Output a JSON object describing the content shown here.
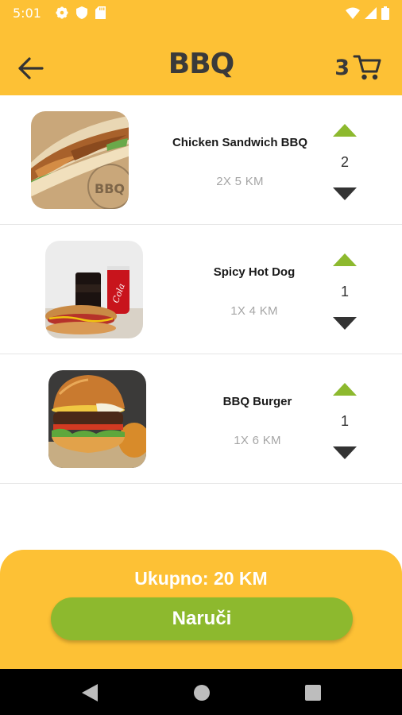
{
  "status_bar": {
    "time": "5:01",
    "left_icons": [
      "gear-icon",
      "shield-icon",
      "sd-card-icon"
    ],
    "right_icons": [
      "wifi-icon",
      "signal-icon",
      "battery-icon"
    ]
  },
  "app_bar": {
    "title": "BBQ",
    "back_icon": "arrow-left-icon",
    "cart_icon": "cart-icon",
    "cart_count": "3"
  },
  "cart_items": [
    {
      "name": "Chicken Sandwich BBQ",
      "price_line": "2X 5 KM",
      "quantity": "2",
      "image": "chicken-sandwich-image"
    },
    {
      "name": "Spicy Hot Dog",
      "price_line": "1X 4 KM",
      "quantity": "1",
      "image": "hot-dog-image"
    },
    {
      "name": "BBQ Burger",
      "price_line": "1X 6 KM",
      "quantity": "1",
      "image": "burger-image"
    }
  ],
  "footer": {
    "total_label": "Ukupno: 20 KM",
    "order_button": "Naruči"
  },
  "colors": {
    "primary": "#FDC135",
    "button_green": "#8DB92E",
    "stepper_up": "#8DB92E",
    "stepper_down": "#333333",
    "price_grey": "#A5A5A5"
  },
  "nav_bar": {
    "icons": [
      "back-triangle-icon",
      "home-circle-icon",
      "recents-square-icon"
    ]
  }
}
